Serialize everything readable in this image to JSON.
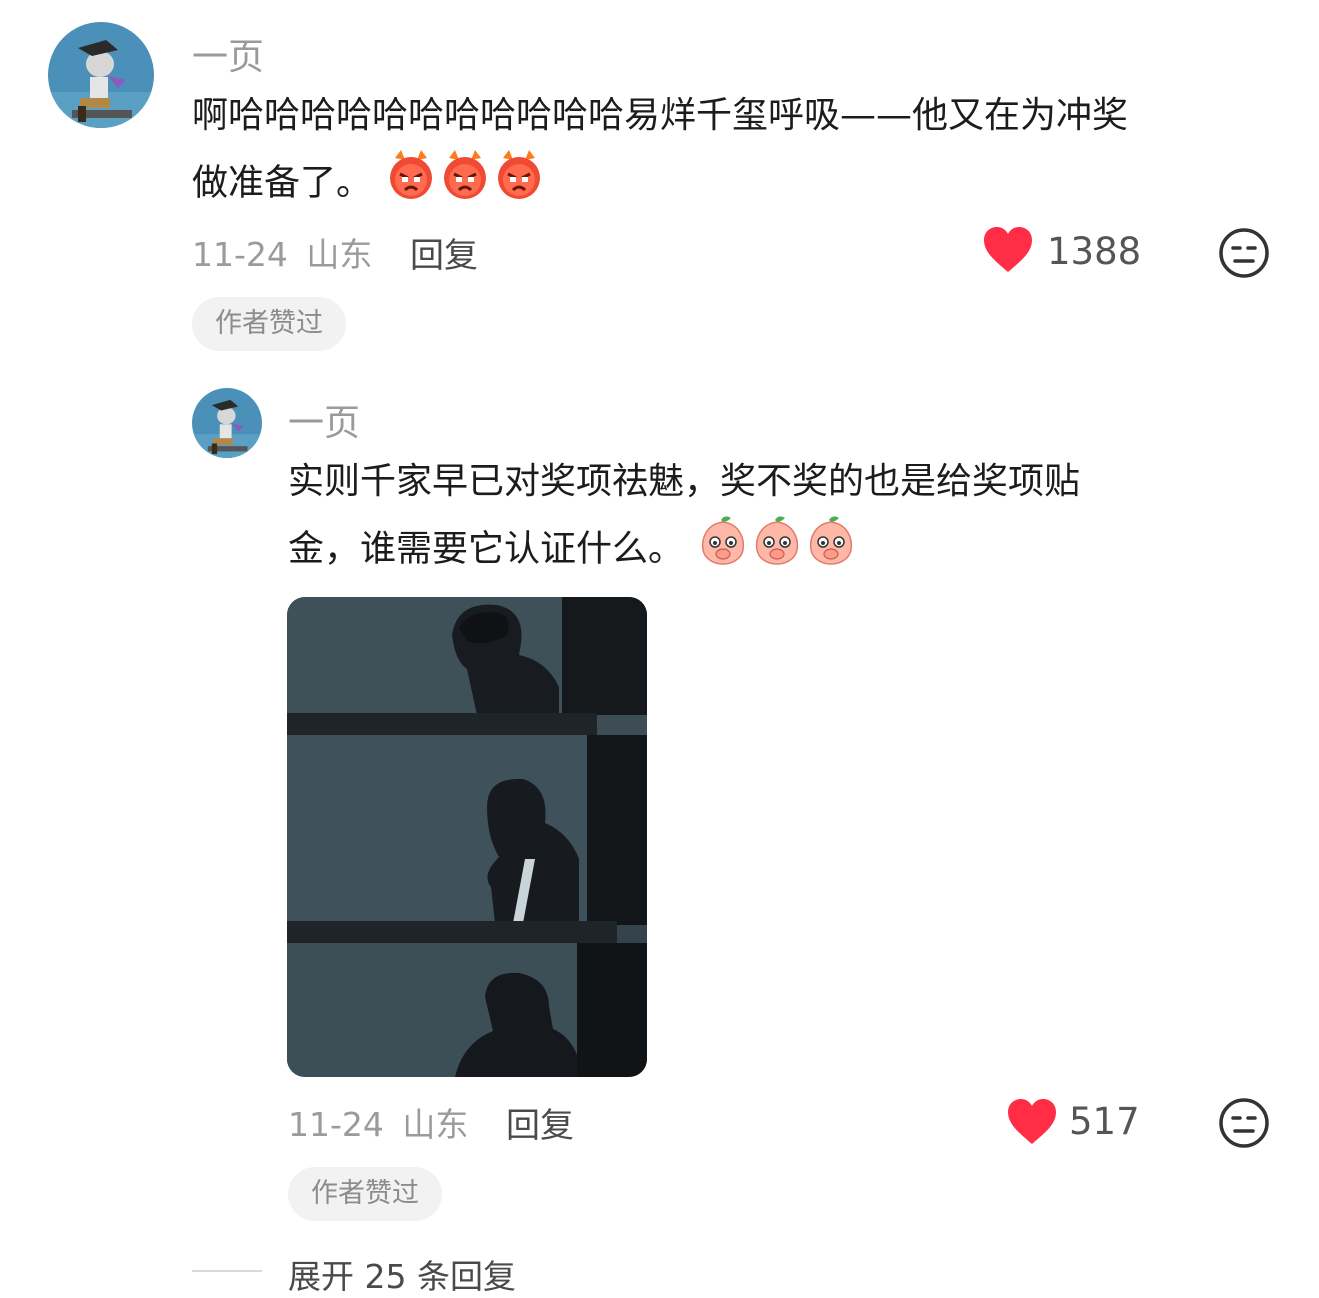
{
  "comment": {
    "username": "一页",
    "text_line1": "啊哈哈哈哈哈哈哈哈哈哈哈易烊千玺呼吸——他又在为冲奖",
    "text_line2": "做准备了。",
    "emoji_icon": "angry-devil-emoji",
    "emoji_count": 3,
    "date": "11-24",
    "location": "山东",
    "reply_label": "回复",
    "likes": "1388",
    "badge": "作者赞过"
  },
  "reply": {
    "username": "一页",
    "text_line1": "实则千家早已对奖项祛魅，奖不奖的也是给奖项贴",
    "text_line2": "金，谁需要它认证什么。",
    "emoji_icon": "shy-peach-emoji",
    "emoji_count": 3,
    "image_subject": "man in dark suit on phone by the sea, three stacked frames",
    "date": "11-24",
    "location": "山东",
    "reply_label": "回复",
    "likes": "517",
    "badge": "作者赞过"
  },
  "expand_replies": "展开 25 条回复",
  "colors": {
    "heart": "#ff2d46",
    "badge_bg": "#f2f2f2",
    "meta": "#9b9b9b"
  }
}
